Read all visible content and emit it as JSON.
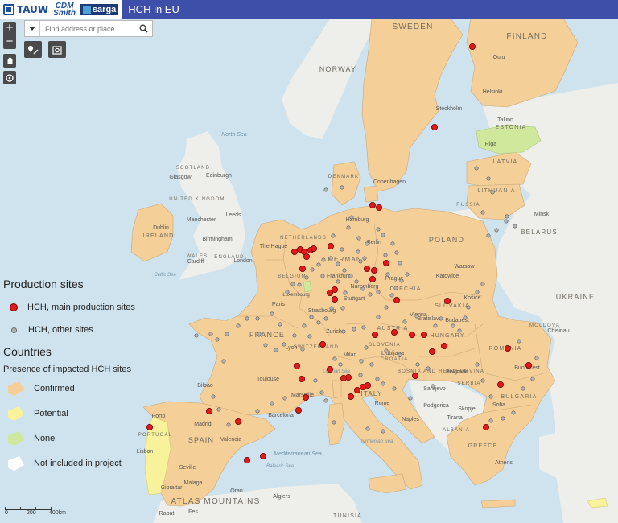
{
  "header": {
    "logo_tauw": "TAUW",
    "logo_cdm_line1": "CDM",
    "logo_cdm_line2": "Smith",
    "logo_sarga": "sarga",
    "title": "HCH in EU"
  },
  "controls": {
    "zoom_in": "+",
    "zoom_out": "−",
    "search_placeholder": "Find address or place"
  },
  "legend": {
    "production_title": "Production sites",
    "main_sites": "HCH, main production sites",
    "other_sites": "HCH, other sites",
    "countries_title": "Countries",
    "presence_subtitle": "Presence of impacted HCH sites",
    "confirmed": "Confirmed",
    "potential": "Potential",
    "none": "None",
    "not_included": "Not included in project"
  },
  "colors": {
    "confirmed": "#f5cf98",
    "potential": "#f7f29b",
    "none": "#cfe89c",
    "not_included": "#ffffff",
    "main_site": "#e21a1a",
    "other_site": "#b3b3b3",
    "sea": "#cfe3ee",
    "land": "#eeeeea",
    "header": "#3d4fa8"
  },
  "scale": {
    "labels": [
      "0",
      "200",
      "400km"
    ]
  },
  "map_labels": {
    "sweden": "SWEDEN",
    "finland": "FINLAND",
    "norway": "NORWAY",
    "estonia": "ESTONIA",
    "latvia": "LATVIA",
    "lithuania": "LITHUANIA",
    "russia": "RUSSIA",
    "belarus": "BELARUS",
    "ukraine": "UKRAINE",
    "moldova": "MOLDOVA",
    "poland": "POLAND",
    "germany": "GERMANY",
    "netherlands": "NETHERLANDS",
    "belgium": "BELGIUM",
    "luxembourg": "Luxembourg",
    "czechia": "CZECHIA",
    "slovakia": "SLOVAKIA",
    "austria": "AUSTRIA",
    "hungary": "HUNGARY",
    "romania": "ROMANIA",
    "bulgaria": "BULGARIA",
    "serbia": "SERBIA",
    "slovenia": "SLOVENIA",
    "croatia": "CROATIA",
    "bosnia": "BOSNIA AND HERZEGOVINA",
    "switzerland": "SWITZERLAND",
    "italy": "ITALY",
    "france": "FRANCE",
    "spain": "SPAIN",
    "portugal": "PORTUGAL",
    "greece": "GREECE",
    "albania": "ALBANIA",
    "uk": "UNITED KINGDOM",
    "ireland": "IRELAND",
    "denmark": "DENMARK",
    "wales": "WALES",
    "england": "ENGLAND",
    "scotland": "SCOTLAND",
    "tunisia": "TUNISIA",
    "atlas": "ATLAS MOUNTAINS",
    "north_sea": "North Sea",
    "mediterranean": "Mediterranean Sea",
    "tyrrhenian": "Tyrrhenian Sea",
    "celtic": "Celtic Sea",
    "balearic": "Balearic Sea",
    "ligurian": "Ligurian Sea",
    "stockholm": "Stockholm",
    "copenhagen": "Copenhagen",
    "berlin": "Berlin",
    "hamburg": "Hamburg",
    "the_hague": "The Hague",
    "paris": "Paris",
    "barcelona": "Barcelona",
    "madrid": "Madrid",
    "lisbon": "Lisbon",
    "valencia": "Valencia",
    "seville": "Seville",
    "porto": "Porto",
    "bilbao": "Bilbao",
    "marseille": "Marseille",
    "toulouse": "Toulouse",
    "lyon": "Lyon",
    "zurich": "Zurich",
    "milan": "Milan",
    "rome": "Rome",
    "naples": "Naples",
    "vienna": "Vienna",
    "prague": "Prague",
    "budapest": "Budapest",
    "belgrade": "Belgrade",
    "sarajevo": "Sarajevo",
    "bucharest": "Bucharest",
    "sofia": "Sofia",
    "warsaw": "Warsaw",
    "katowice": "Katowice",
    "minsk": "Minsk",
    "riga": "Riga",
    "helsinki": "Helsinki",
    "london": "London",
    "dublin": "Dublin",
    "manchester": "Manchester",
    "birmingham": "Birmingham",
    "glasgow": "Glasgow",
    "edinburgh": "Edinburgh",
    "leeds": "Leeds",
    "cardiff": "Cardiff",
    "stuttgart": "Stuttgart",
    "frankfurt": "Frankfurt",
    "strasbourg": "Strasbourg",
    "nuremberg": "Nuremberg",
    "ljubljana": "Ljubljana",
    "bratislava": "Bratislava",
    "kosice": "Košice",
    "podgorica": "Podgorica",
    "skopje": "Skopje",
    "tirana": "Tirana",
    "chisinau": "Chisinau",
    "tallinn": "Tallinn",
    "oulu": "Oulu",
    "algiers": "Algiers",
    "rabat": "Rabat",
    "fes": "Fes",
    "oran": "Oran",
    "gibraltar": "Gibraltar",
    "malaga": "Malaga",
    "athens": "Athens"
  }
}
